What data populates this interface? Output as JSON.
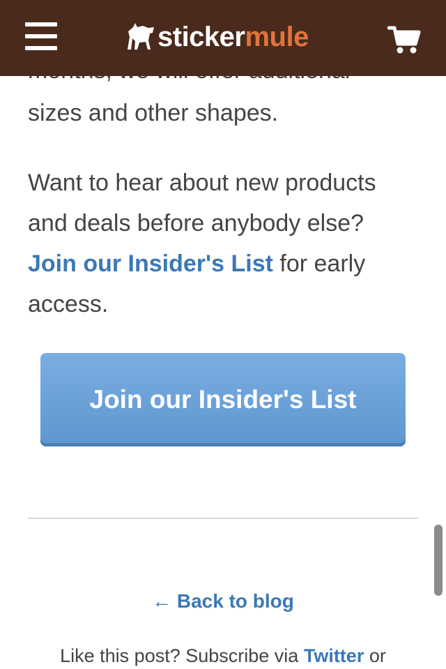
{
  "header": {
    "logo_part1": "sticker",
    "logo_part2": "mule",
    "colors": {
      "bar": "#4a2a1c",
      "logo_accent": "#e0743c"
    },
    "icons": {
      "menu": "hamburger-menu-icon",
      "cart": "shopping-cart-icon",
      "logo": "horse-logo-icon"
    }
  },
  "article": {
    "partial_line": "months, we will offer additional",
    "p1": "sizes and other shapes.",
    "p2_text": "Want to hear about new products and deals before anybody else?",
    "p2_link": "Join our Insider's List",
    "p2_suffix": "for early access."
  },
  "cta_button": {
    "label": "Join our Insider's List",
    "color": "#6fa3dc"
  },
  "footer": {
    "back_link": "← Back to blog",
    "subscribe_prefix": "Like this post? Subscribe via",
    "subscribe_twitter": "Twitter",
    "subscribe_suffix": "or"
  },
  "colors": {
    "link": "#3b78b5",
    "text": "#444444"
  }
}
